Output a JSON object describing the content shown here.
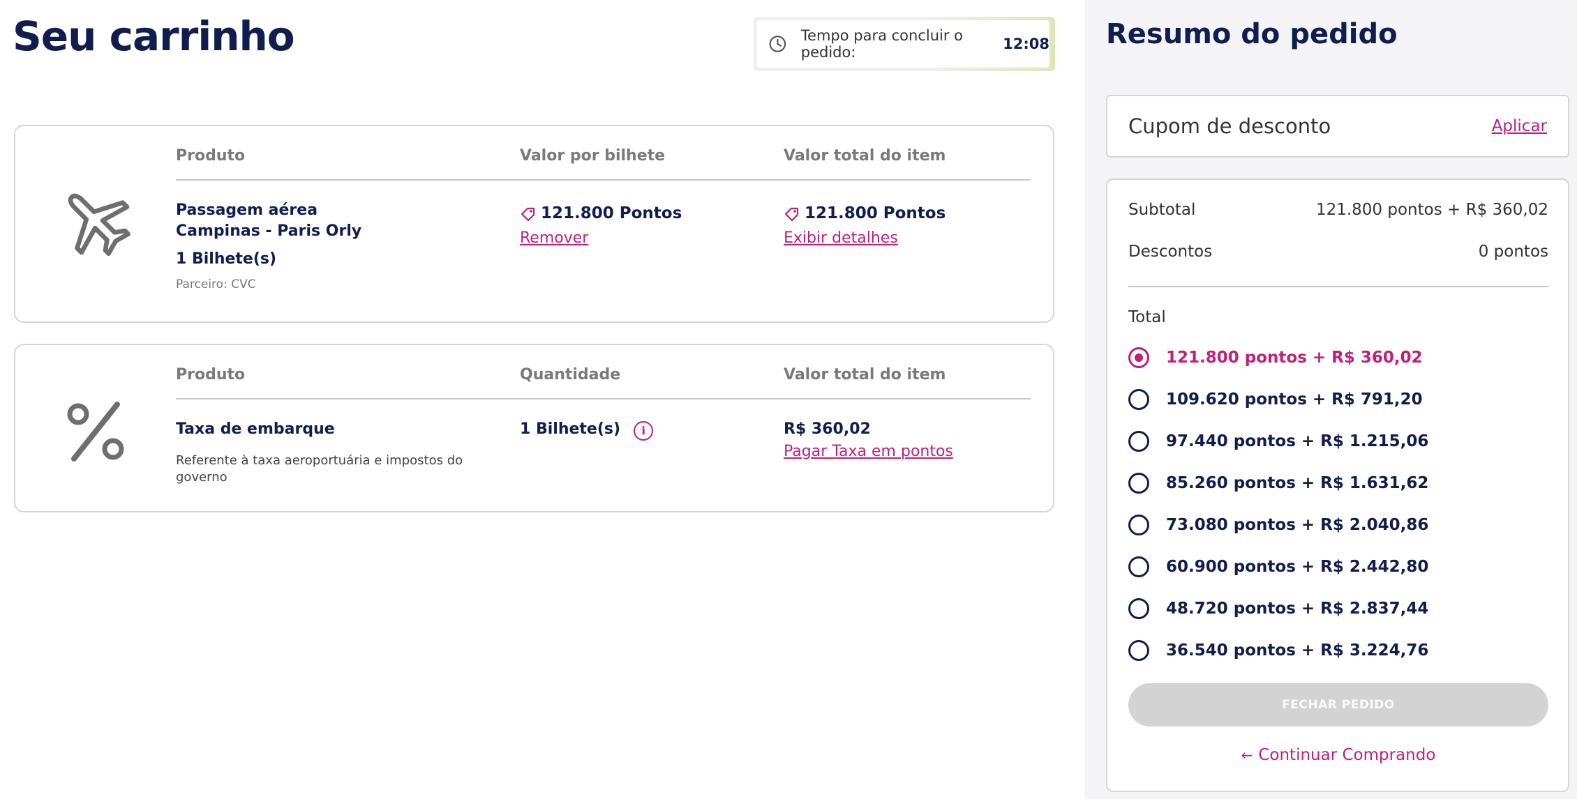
{
  "cart": {
    "title": "Seu carrinho",
    "timer": {
      "label": "Tempo para concluir o pedido:",
      "value": "12:08"
    },
    "flight": {
      "headers": [
        "Produto",
        "Valor por bilhete",
        "Valor total do item"
      ],
      "name": "Passagem aérea",
      "route": "Campinas - Paris Orly",
      "tickets": "1 Bilhete(s)",
      "partner": "Parceiro: CVC",
      "price_per_ticket": "121.800 Pontos",
      "remove_label": "Remover",
      "total": "121.800 Pontos",
      "details_label": "Exibir detalhes"
    },
    "fee": {
      "headers": [
        "Produto",
        "Quantidade",
        "Valor total do item"
      ],
      "name": "Taxa de embarque",
      "description": "Referente à taxa aeroportuária e impostos do governo",
      "quantity": "1 Bilhete(s)",
      "info_glyph": "i",
      "total": "R$ 360,02",
      "pay_points_label": "Pagar Taxa em pontos"
    }
  },
  "summary": {
    "title": "Resumo do pedido",
    "coupon": {
      "label": "Cupom de desconto",
      "apply_label": "Aplicar"
    },
    "subtotal": {
      "label": "Subtotal",
      "value": "121.800 pontos + R$ 360,02"
    },
    "discounts": {
      "label": "Descontos",
      "value": "0 pontos"
    },
    "total_label": "Total",
    "options": [
      {
        "label": "121.800 pontos + R$ 360,02",
        "selected": true
      },
      {
        "label": "109.620 pontos + R$ 791,20",
        "selected": false
      },
      {
        "label": "97.440 pontos + R$ 1.215,06",
        "selected": false
      },
      {
        "label": "85.260 pontos + R$ 1.631,62",
        "selected": false
      },
      {
        "label": "73.080 pontos + R$ 2.040,86",
        "selected": false
      },
      {
        "label": "60.900 pontos + R$ 2.442,80",
        "selected": false
      },
      {
        "label": "48.720 pontos + R$ 2.837,44",
        "selected": false
      },
      {
        "label": "36.540 pontos + R$ 3.224,76",
        "selected": false
      }
    ],
    "close_button": "FECHAR PEDIDO",
    "continue_label": "Continuar Comprando",
    "continue_arrow": "←"
  },
  "colors": {
    "accent": "#c21e78",
    "navy": "#101d4f",
    "disabled": "#d3d3d3"
  },
  "icons": [
    "clock-icon",
    "airplane-icon",
    "percent-icon",
    "points-tag-icon",
    "info-icon",
    "arrow-left-icon"
  ]
}
